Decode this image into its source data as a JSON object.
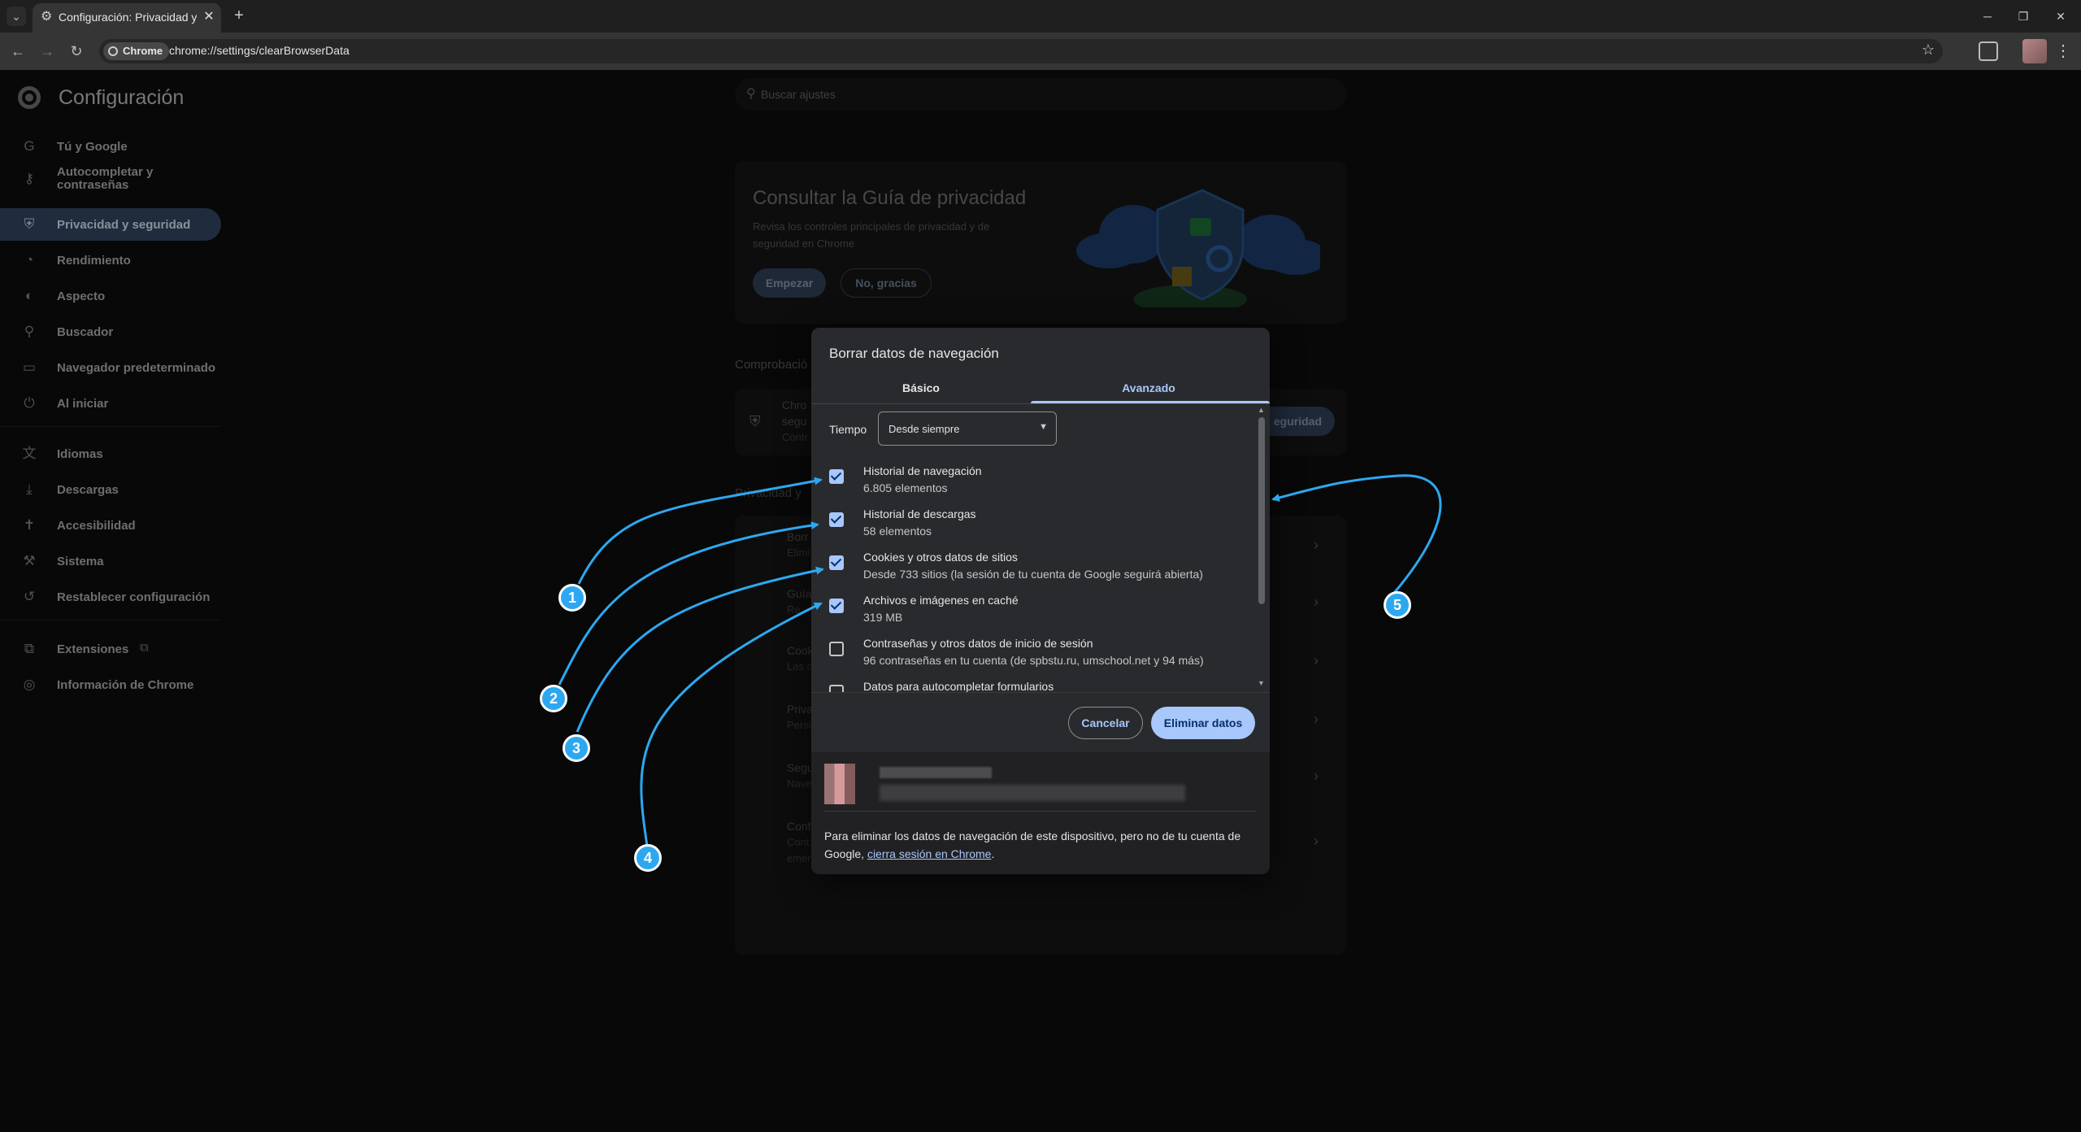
{
  "browser": {
    "tab_title": "Configuración: Privacidad y seg",
    "omnibox_chip": "Chrome",
    "url": "chrome://settings/clearBrowserData"
  },
  "settings": {
    "title": "Configuración",
    "search_placeholder": "Buscar ajustes",
    "nav": [
      {
        "label": "Tú y Google",
        "icon": "google-g-icon"
      },
      {
        "label": "Autocompletar y contraseñas",
        "icon": "key-icon"
      },
      {
        "label": "Privacidad y seguridad",
        "icon": "shield-icon",
        "active": true
      },
      {
        "label": "Rendimiento",
        "icon": "gauge-icon"
      },
      {
        "label": "Aspecto",
        "icon": "palette-icon"
      },
      {
        "label": "Buscador",
        "icon": "search-icon"
      },
      {
        "label": "Navegador predeterminado",
        "icon": "browser-window-icon"
      },
      {
        "label": "Al iniciar",
        "icon": "power-icon"
      },
      {
        "label": "Idiomas",
        "icon": "translate-icon"
      },
      {
        "label": "Descargas",
        "icon": "download-icon"
      },
      {
        "label": "Accesibilidad",
        "icon": "accessibility-icon"
      },
      {
        "label": "Sistema",
        "icon": "wrench-icon"
      },
      {
        "label": "Restablecer configuración",
        "icon": "reset-icon"
      },
      {
        "label": "Extensiones",
        "icon": "puzzle-icon"
      },
      {
        "label": "Información de Chrome",
        "icon": "chrome-icon"
      }
    ],
    "guide": {
      "title": "Consultar la Guía de privacidad",
      "description": "Revisa los controles principales de privacidad y de seguridad en Chrome",
      "start": "Empezar",
      "no_thanks": "No, gracias"
    },
    "background_fragments": {
      "safety_heading": "Comprobació",
      "safety_line1": "Chro",
      "safety_line2": "segu",
      "safety_line3": "Contr",
      "safety_button": "eguridad",
      "privacy_heading": "Privacidad y",
      "row1a": "Borr",
      "row1b": "Elimi",
      "row2a": "Guía",
      "row2b": "Re",
      "row3a": "Cook",
      "row3b": "Las c",
      "row4a": "Priva",
      "row4b": "Perso",
      "row5a": "Segu",
      "row5b": "Nave",
      "row6a": "Conf",
      "row6b": "Cont",
      "row6c": "emer"
    }
  },
  "dialog": {
    "title": "Borrar datos de navegación",
    "tabs": [
      "Básico",
      "Avanzado"
    ],
    "active_tab": "Avanzado",
    "time_label": "Tiempo",
    "time_value": "Desde siempre",
    "options": [
      {
        "title": "Historial de navegación",
        "subtitle": "6.805 elementos",
        "checked": true
      },
      {
        "title": "Historial de descargas",
        "subtitle": "58 elementos",
        "checked": true
      },
      {
        "title": "Cookies y otros datos de sitios",
        "subtitle": "Desde 733 sitios (la sesión de tu cuenta de Google seguirá abierta)",
        "checked": true
      },
      {
        "title": "Archivos e imágenes en caché",
        "subtitle": "319 MB",
        "checked": true
      },
      {
        "title": "Contraseñas y otros datos de inicio de sesión",
        "subtitle": "96 contraseñas en tu cuenta (de spbstu.ru, umschool.net y 94 más)",
        "checked": false
      },
      {
        "title": "Datos para autocompletar formularios",
        "subtitle": "",
        "checked": false
      }
    ],
    "cancel": "Cancelar",
    "delete": "Eliminar datos",
    "footer_text": "Para eliminar los datos de navegación de este dispositivo, pero no de tu cuenta de Google, ",
    "footer_link": "cierra sesión en Chrome",
    "footer_end": "."
  },
  "annotations": {
    "color": "#2da8f0",
    "badges": [
      "1",
      "2",
      "3",
      "4",
      "5"
    ]
  }
}
